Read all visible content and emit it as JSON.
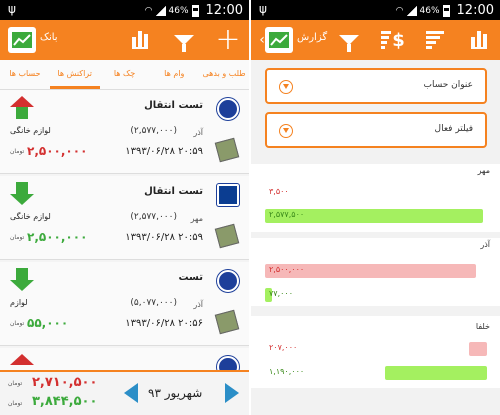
{
  "status_bar": {
    "battery": "46%",
    "time": "12:00"
  },
  "left": {
    "title": "بانک",
    "tabs": [
      "حساب ها",
      "تراکنش ها",
      "چک ها",
      "وام ها",
      "طلب و بدهی"
    ],
    "active_tab": 1,
    "transactions": [
      {
        "title": "تست انتقال",
        "month": "آذر",
        "balance": "(۲,۵۷۷,۰۰۰)",
        "date": "۱۳۹۳/۰۶/۲۸ ۲۰:۵۹",
        "status": "لوازم خانگی",
        "amount": "۲,۵۰۰,۰۰۰",
        "unit": "تومان",
        "direction": "out"
      },
      {
        "title": "تست انتقال",
        "month": "مهر",
        "balance": "(۲,۵۷۷,۰۰۰)",
        "date": "۱۳۹۳/۰۶/۲۸ ۲۰:۵۹",
        "status": "لوازم خانگی",
        "amount": "۲,۵۰۰,۰۰۰",
        "unit": "تومان",
        "direction": "in"
      },
      {
        "title": "تست",
        "month": "آذر",
        "balance": "(۵,۰۷۷,۰۰۰)",
        "date": "۱۳۹۳/۰۶/۲۸ ۲۰:۵۶",
        "status": "لوازم",
        "amount": "۵۵,۰۰۰",
        "unit": "تومان",
        "direction": "in"
      }
    ],
    "footer": {
      "expense": "۲,۷۱۰,۵۰۰",
      "income": "۳,۸۴۴,۵۰۰",
      "unit": "تومان",
      "month": "شهریور ۹۳"
    }
  },
  "right": {
    "title": "گزارش",
    "filter_account": "عنوان حساب",
    "filter_active": "فیلتر فعال",
    "sections": [
      {
        "label": "مهر",
        "expense": "۳,۵۰۰",
        "income": "۲,۵۷۷,۵۰۰",
        "expense_fraction": 0.0,
        "income_fraction": 0.98
      },
      {
        "label": "آذر",
        "expense": "۲,۵۰۰,۰۰۰",
        "income": "۷۷,۰۰۰",
        "expense_fraction": 0.95,
        "income_fraction": 0.03
      },
      {
        "label": "خلفا",
        "expense": "۲۰۷,۰۰۰",
        "income": "۱,۱۹۰,۰۰۰",
        "expense_fraction": 0.08,
        "income_fraction": 0.46
      }
    ]
  },
  "colors": {
    "accent": "#f58220",
    "expense": "#d32f2f",
    "income": "#3caa3c",
    "nav_arrow": "#2b8ec7"
  },
  "icons": {
    "left_toolbar": [
      "app-logo-icon",
      "bar-chart-icon",
      "filter-icon",
      "plus-icon"
    ],
    "right_toolbar": [
      "back-chevron-icon",
      "filter-icon",
      "currency-sort-icon",
      "sort-icon",
      "bar-chart-icon"
    ]
  }
}
